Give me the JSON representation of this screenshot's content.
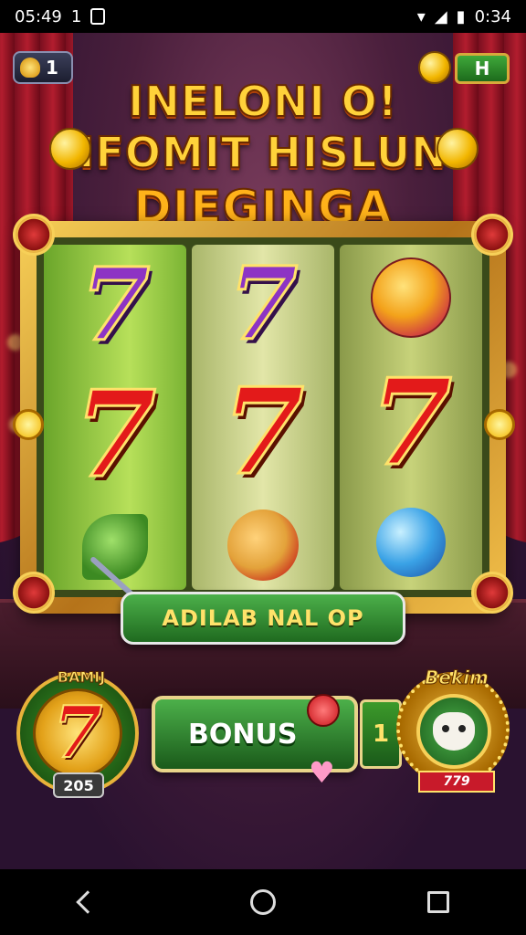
{
  "status_bar": {
    "time_left": "05:49",
    "indicator_left": "1",
    "time_right": "0:34"
  },
  "hud": {
    "lives_count": "1",
    "top_right_button": "H"
  },
  "title": {
    "line1": "INELONI O!",
    "line2": "IFOMIT HISLUN",
    "line3": "DIEGINGA"
  },
  "reels": [
    [
      "purple-seven",
      "red-seven",
      "leaf-fruit"
    ],
    [
      "purple-seven",
      "red-seven",
      "apple-fruit"
    ],
    [
      "pear-fruit",
      "red-seven",
      "blue-fruit"
    ]
  ],
  "spin_banner": {
    "label": "ADILAB NAL OP"
  },
  "bottom": {
    "left_badge_label": "BAMIJ",
    "left_badge_count": "205",
    "bonus_label": "BONUS",
    "side_button_label": "1",
    "right_badge_label": "Bekim",
    "right_badge_value": "779"
  },
  "colors": {
    "gold": "#f7d058",
    "green_button": "#4cb04a",
    "red_seven": "#e31a1a",
    "purple_seven": "#8d34c4"
  },
  "seven_glyph": "7"
}
